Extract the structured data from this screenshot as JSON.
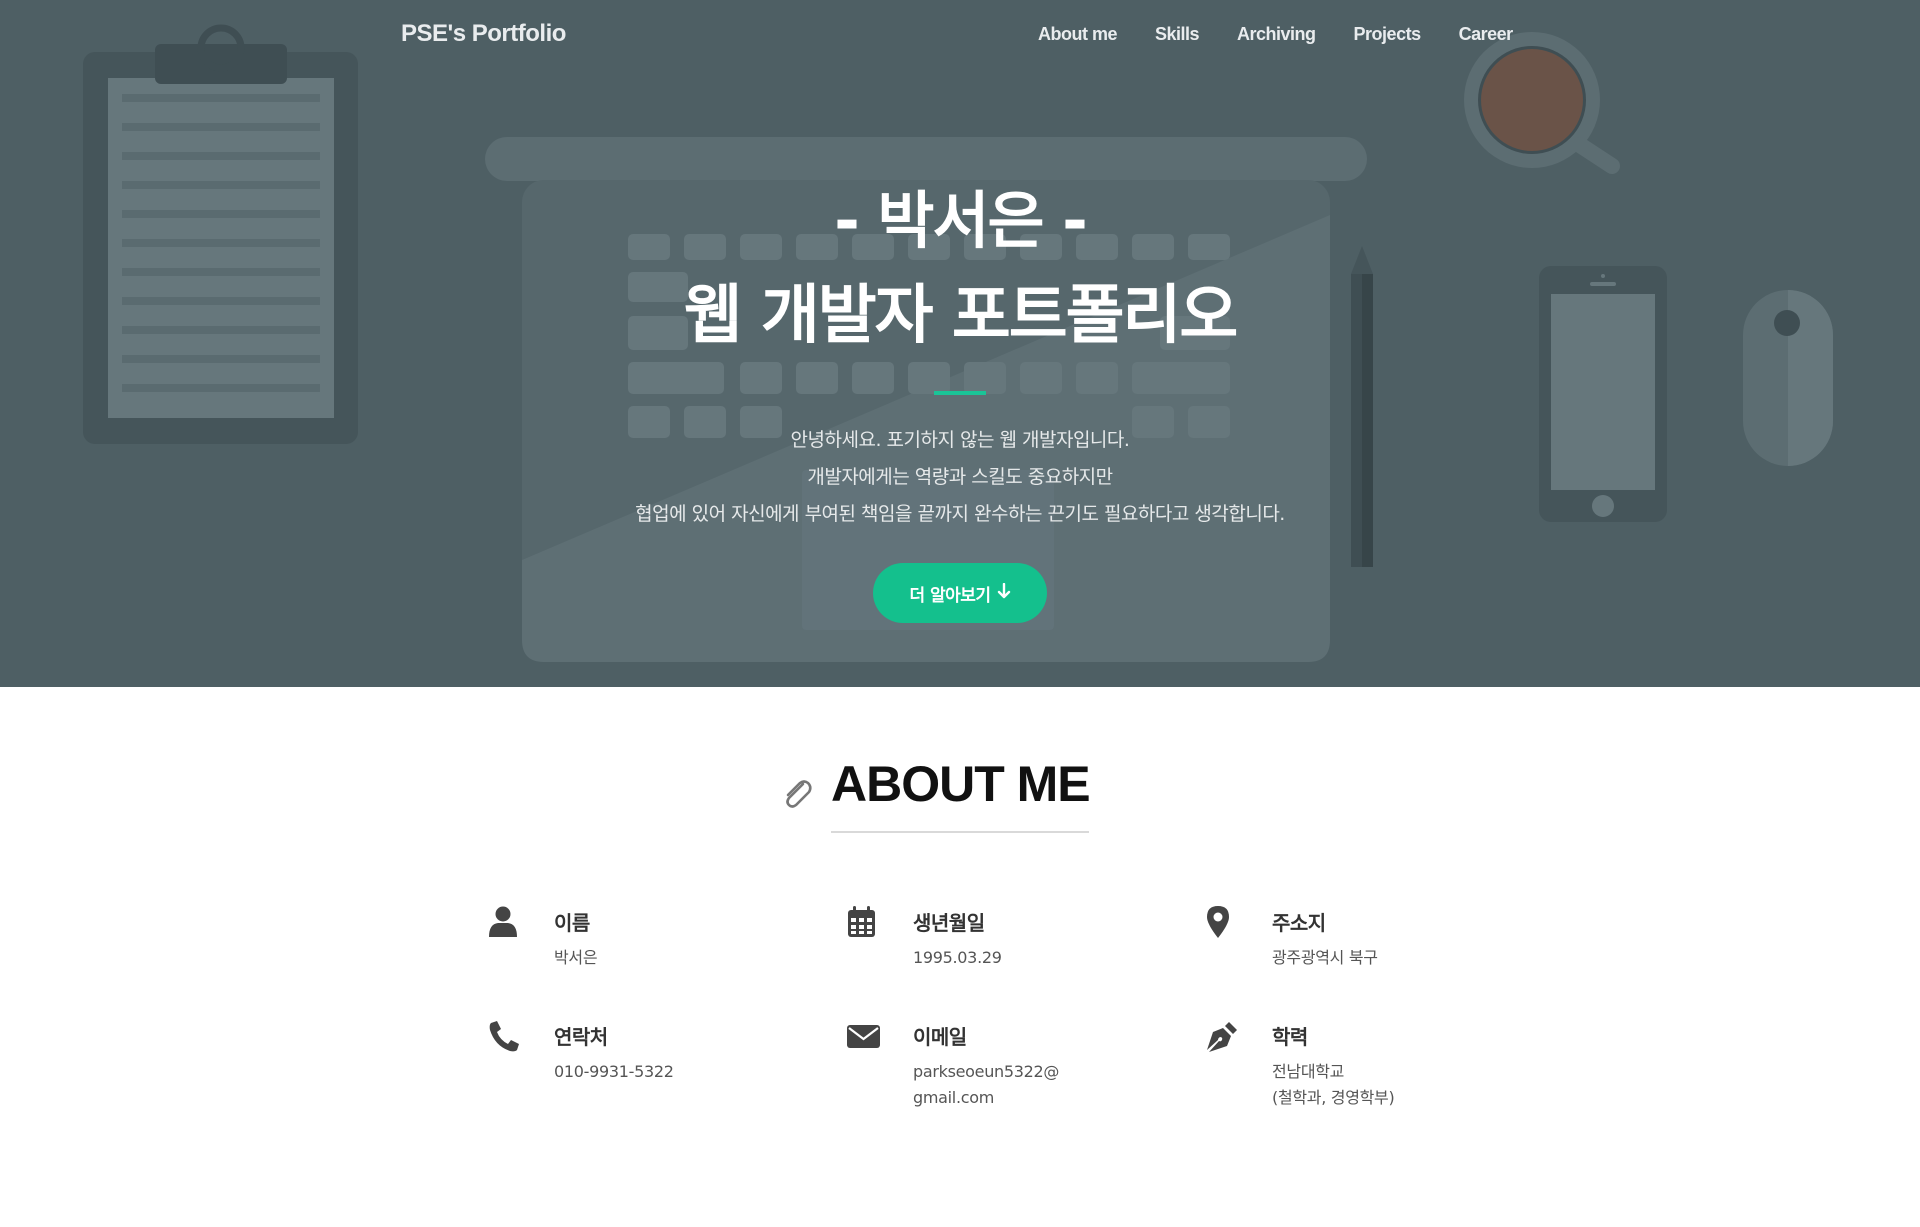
{
  "nav": {
    "brand": "PSE's Portfolio",
    "links": [
      "About me",
      "Skills",
      "Archiving",
      "Projects",
      "Career"
    ]
  },
  "hero": {
    "title_line1": "- 박서은 -",
    "title_line2": "웹 개발자 포트폴리오",
    "intro": [
      "안녕하세요. 포기하지 않는 웹 개발자입니다.",
      "개발자에게는 역량과 스킬도 중요하지만",
      "협업에 있어 자신에게 부여된 책임을 끝까지 완수하는 끈기도 필요하다고 생각합니다."
    ],
    "button_label": "더 알아보기",
    "button_icon": "arrow-down-icon"
  },
  "about": {
    "title": "ABOUT ME",
    "title_icon": "paperclip-icon",
    "items": [
      {
        "icon": "user-icon",
        "label": "이름",
        "value": [
          "박서은"
        ]
      },
      {
        "icon": "calendar-icon",
        "label": "생년월일",
        "value": [
          "1995.03.29"
        ]
      },
      {
        "icon": "map-marker-icon",
        "label": "주소지",
        "value": [
          "광주광역시 북구"
        ]
      },
      {
        "icon": "phone-icon",
        "label": "연락처",
        "value": [
          "010-9931-5322"
        ]
      },
      {
        "icon": "envelope-icon",
        "label": "이메일",
        "value": [
          "parkseoeun5322@",
          "gmail.com"
        ]
      },
      {
        "icon": "pen-nib-icon",
        "label": "학력",
        "value": [
          "전남대학교",
          "(철학과, 경영학부)"
        ]
      }
    ]
  },
  "colors": {
    "hero_bg": "#4e5f64",
    "accent": "#14c08d",
    "text_dark": "#333333"
  }
}
